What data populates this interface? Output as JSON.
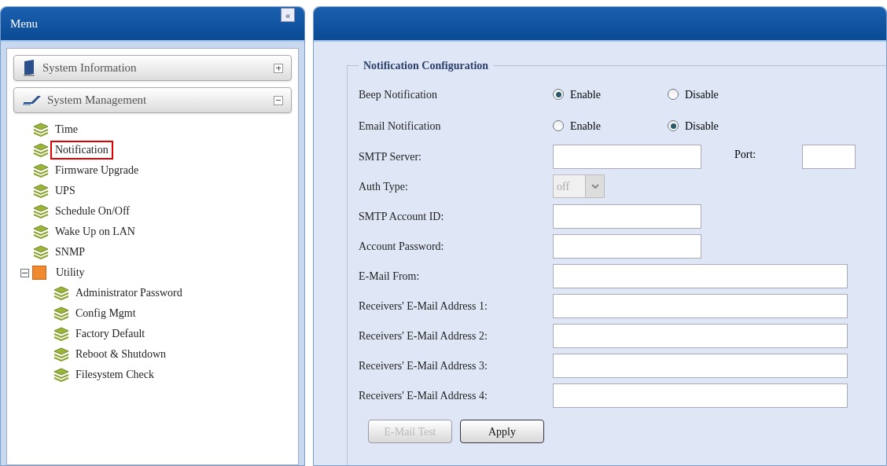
{
  "menu": {
    "title": "Menu",
    "collapse_label": "«",
    "sections": [
      {
        "label": "System Information",
        "expanded": false,
        "kind": "monitor"
      },
      {
        "label": "System Management",
        "expanded": true,
        "kind": "tools"
      }
    ],
    "tree": [
      {
        "label": "Time",
        "highlighted": false
      },
      {
        "label": "Notification",
        "highlighted": true
      },
      {
        "label": "Firmware Upgrade",
        "highlighted": false
      },
      {
        "label": "UPS",
        "highlighted": false
      },
      {
        "label": "Schedule On/Off",
        "highlighted": false
      },
      {
        "label": "Wake Up on LAN",
        "highlighted": false
      },
      {
        "label": "SNMP",
        "highlighted": false
      },
      {
        "label": "Utility",
        "highlighted": false,
        "expanded": true,
        "children": [
          {
            "label": "Administrator Password",
            "highlighted": false
          },
          {
            "label": "Config Mgmt",
            "highlighted": false
          },
          {
            "label": "Factory Default",
            "highlighted": false
          },
          {
            "label": "Reboot & Shutdown",
            "highlighted": false
          },
          {
            "label": "Filesystem Check",
            "highlighted": false
          }
        ]
      }
    ]
  },
  "form": {
    "legend": "Notification Configuration",
    "rows": [
      {
        "kind": "radio",
        "label": "Beep Notification",
        "options": [
          {
            "label": "Enable",
            "selected": true
          },
          {
            "label": "Disable",
            "selected": false
          }
        ]
      },
      {
        "kind": "radio",
        "label": "Email Notification",
        "options": [
          {
            "label": "Enable",
            "selected": false
          },
          {
            "label": "Disable",
            "selected": true
          }
        ]
      },
      {
        "kind": "server",
        "label": "SMTP Server:",
        "port_label": "Port:"
      },
      {
        "kind": "select",
        "label": "Auth Type:",
        "value": "off",
        "disabled": true
      },
      {
        "kind": "short",
        "label": "SMTP Account ID:"
      },
      {
        "kind": "short",
        "label": "Account Password:"
      },
      {
        "kind": "long",
        "label": "E-Mail From:"
      },
      {
        "kind": "long",
        "label": "Receivers' E-Mail Address 1:"
      },
      {
        "kind": "long",
        "label": "Receivers' E-Mail Address 2:"
      },
      {
        "kind": "long",
        "label": "Receivers' E-Mail Address 3:"
      },
      {
        "kind": "long",
        "label": "Receivers' E-Mail Address 4:"
      }
    ],
    "buttons": [
      {
        "label": "E-Mail Test",
        "disabled": true
      },
      {
        "label": "Apply",
        "disabled": false
      }
    ]
  }
}
